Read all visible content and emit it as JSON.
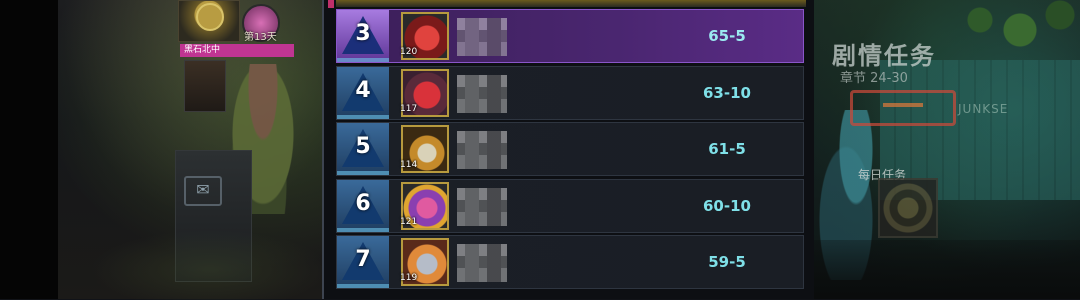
{
  "left_scene": {
    "day_label": "第13天",
    "tag_label": "黑石北中",
    "mail_icon": "mail-icon"
  },
  "leaderboard": {
    "rows": [
      {
        "rank": "3",
        "level": "120",
        "score": "65-5",
        "selected": true,
        "avatar": "game-over-avatar"
      },
      {
        "rank": "4",
        "level": "117",
        "score": "63-10",
        "selected": false,
        "avatar": "boxing-glove-avatar"
      },
      {
        "rank": "5",
        "level": "114",
        "score": "61-5",
        "selected": false,
        "avatar": "crowned-skull-avatar"
      },
      {
        "rank": "6",
        "level": "121",
        "score": "60-10",
        "selected": false,
        "avatar": "monster-egg-avatar"
      },
      {
        "rank": "7",
        "level": "119",
        "score": "59-5",
        "selected": false,
        "avatar": "girl-portrait-avatar"
      }
    ]
  },
  "right_scene": {
    "story_title": "剧情任务",
    "chapter": "章节 24-30",
    "junk_sign": "JUNKSE",
    "daily_label": "每日任务"
  },
  "colors": {
    "selected_row": "#4a2670",
    "score_text": "#7fe0e8",
    "rank_badge": "#3a6a9a"
  }
}
